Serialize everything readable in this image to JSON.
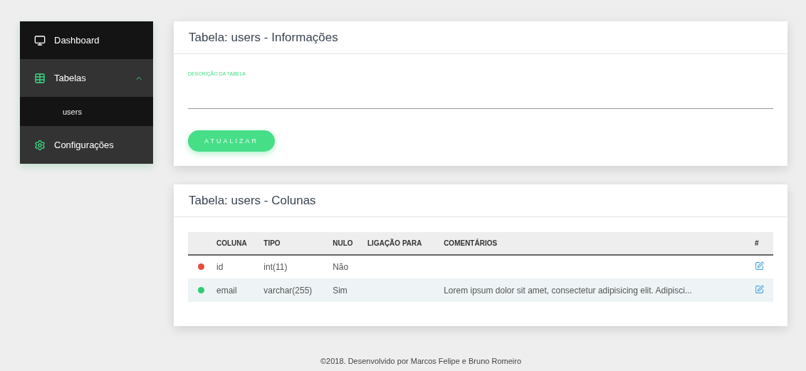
{
  "sidebar": {
    "items": [
      {
        "label": "Dashboard"
      },
      {
        "label": "Tabelas",
        "expanded": true,
        "children": [
          {
            "label": "users"
          }
        ]
      },
      {
        "label": "Configurações"
      }
    ]
  },
  "info_card": {
    "title": "Tabela: users - Informações",
    "field": {
      "label": "DESCRIÇÃO DA TABELA"
    },
    "button": "ATUALIZAR"
  },
  "columns_card": {
    "title": "Tabela: users - Colunas",
    "table": {
      "columns": [
        "COLUNA",
        "TIPO",
        "NULO",
        "LIGAÇÃO PARA",
        "COMENTÁRIOS",
        "#"
      ],
      "rows": [
        {
          "color": "#e74c3c",
          "cells": [
            "id",
            "int(11)",
            "Não",
            "",
            ""
          ]
        },
        {
          "color": "#2ecc71",
          "cells": [
            "email",
            "varchar(255)",
            "Sim",
            "",
            "Lorem ipsum dolor sit amet, consectetur adipisicing elit. Adipisci..."
          ]
        }
      ]
    }
  },
  "footer": "©2018. Desenvolvido por Marcos Felipe e Bruno Romeiro"
}
